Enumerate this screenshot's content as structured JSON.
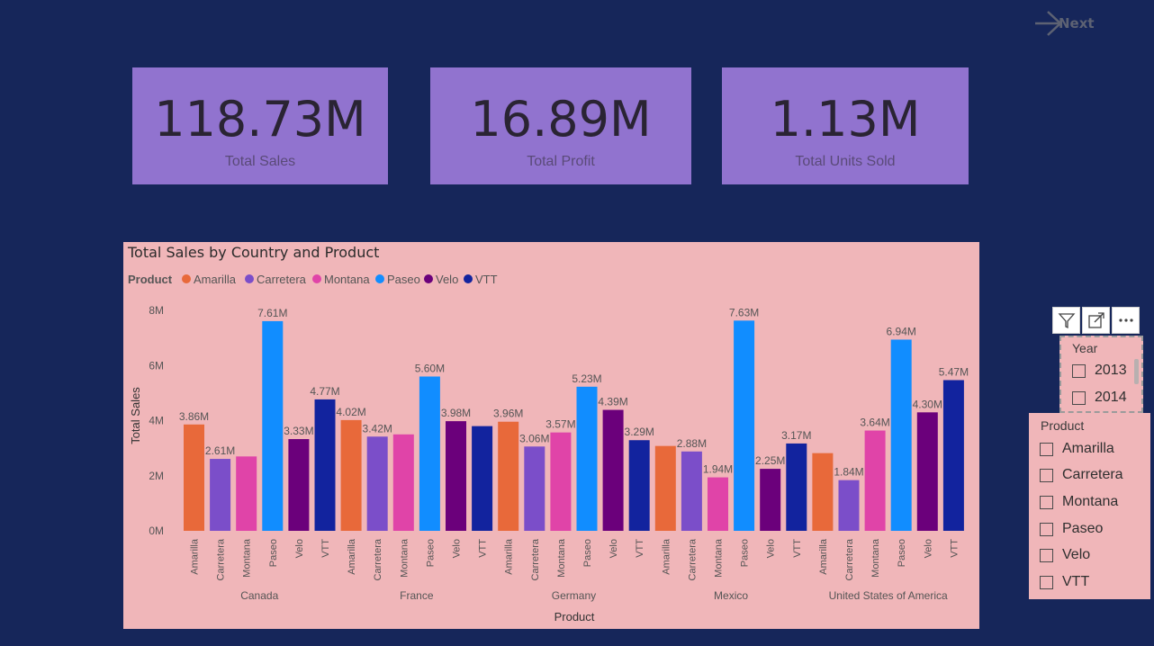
{
  "nav": {
    "next_label": "Next"
  },
  "kpis": [
    {
      "value": "118.73M",
      "label": "Total Sales"
    },
    {
      "value": "16.89M",
      "label": "Total Profit"
    },
    {
      "value": "1.13M",
      "label": "Total Units Sold"
    }
  ],
  "colors": {
    "background": "#16265a",
    "kpi_card": "#9173cf",
    "chart_panel": "#f0b6b9",
    "Amarilla": "#e8693a",
    "Carretera": "#7b4ec9",
    "Montana": "#e044a8",
    "Paseo": "#118dff",
    "Velo": "#6b007b",
    "VTT": "#12239e"
  },
  "chart_data": {
    "type": "bar",
    "title": "Total Sales by Country and Product",
    "legend_title": "Product",
    "legend_position": "top-left",
    "xlabel": "Product",
    "ylabel": "Total Sales",
    "ylim": [
      0,
      8000000
    ],
    "yticks": [
      "0M",
      "2M",
      "4M",
      "6M",
      "8M"
    ],
    "grid": false,
    "products": [
      "Amarilla",
      "Carretera",
      "Montana",
      "Paseo",
      "Velo",
      "VTT"
    ],
    "groups": [
      {
        "country": "Canada",
        "values": [
          3.86,
          2.61,
          2.7,
          7.61,
          3.33,
          4.77
        ],
        "labels": [
          "3.86M",
          "2.61M",
          "",
          "7.61M",
          "3.33M",
          "4.77M"
        ]
      },
      {
        "country": "France",
        "values": [
          4.02,
          3.42,
          3.5,
          5.6,
          3.98,
          3.8
        ],
        "labels": [
          "4.02M",
          "3.42M",
          "",
          "5.60M",
          "3.98M",
          ""
        ]
      },
      {
        "country": "Germany",
        "values": [
          3.96,
          3.06,
          3.57,
          5.23,
          4.39,
          3.29
        ],
        "labels": [
          "3.96M",
          "3.06M",
          "3.57M",
          "5.23M",
          "4.39M",
          "3.29M"
        ]
      },
      {
        "country": "Mexico",
        "values": [
          3.08,
          2.88,
          1.94,
          7.63,
          2.25,
          3.17
        ],
        "labels": [
          "",
          "2.88M",
          "1.94M",
          "7.63M",
          "2.25M",
          "3.17M"
        ]
      },
      {
        "country": "United States of America",
        "values": [
          2.82,
          1.84,
          3.64,
          6.94,
          4.3,
          5.47
        ],
        "labels": [
          "",
          "1.84M",
          "3.64M",
          "6.94M",
          "4.30M",
          "5.47M"
        ]
      }
    ]
  },
  "slicer_year": {
    "title": "Year",
    "items": [
      "2013",
      "2014"
    ]
  },
  "slicer_product": {
    "title": "Product",
    "items": [
      "Amarilla",
      "Carretera",
      "Montana",
      "Paseo",
      "Velo",
      "VTT"
    ]
  }
}
